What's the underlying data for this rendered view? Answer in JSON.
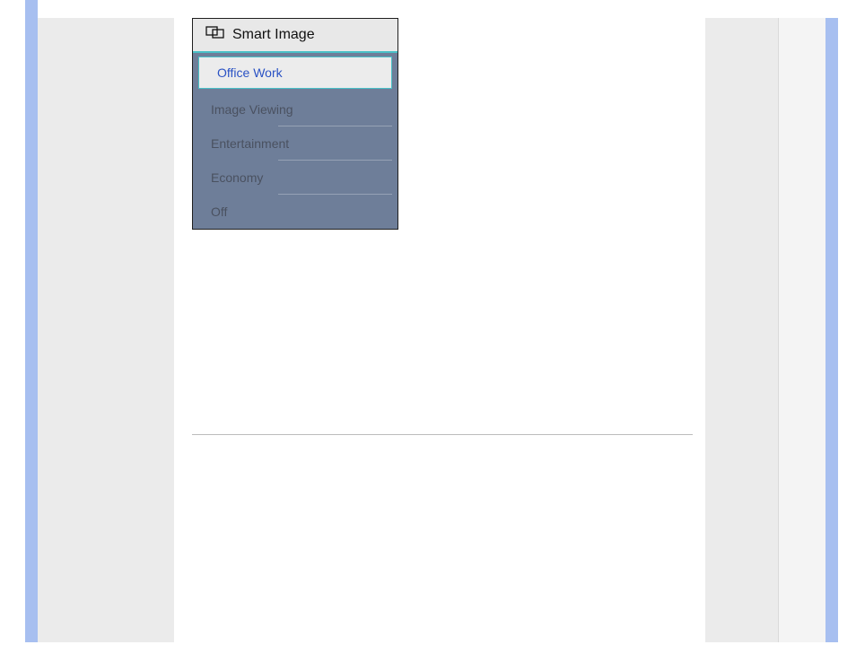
{
  "panel": {
    "title": "Smart Image",
    "options": {
      "office": "Office Work",
      "imageViewing": "Image Viewing",
      "entertainment": "Entertainment",
      "economy": "Economy",
      "off": "Off"
    }
  }
}
